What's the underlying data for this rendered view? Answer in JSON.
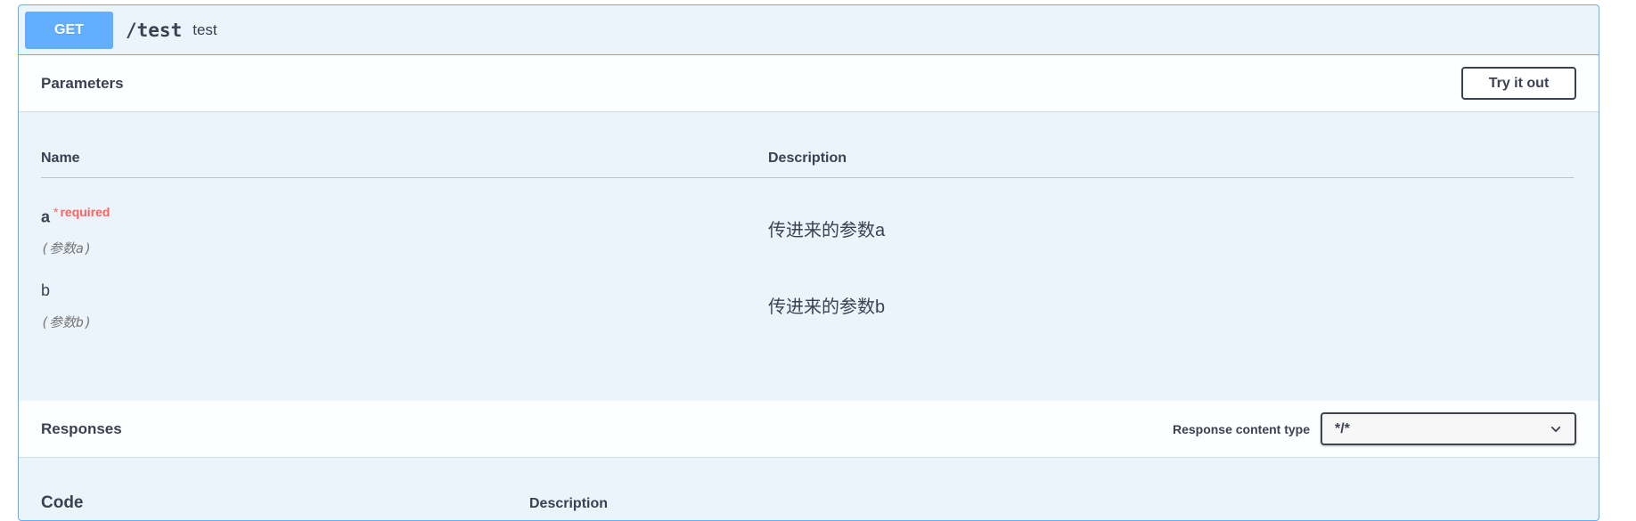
{
  "operation": {
    "method": "GET",
    "path": "/test",
    "summary": "test"
  },
  "parameters": {
    "title": "Parameters",
    "try_button": "Try it out",
    "col_name": "Name",
    "col_description": "Description",
    "items": [
      {
        "name": "a",
        "required_star": "*",
        "required_label": "required",
        "in": "(参数a)",
        "description": "传进来的参数a"
      },
      {
        "name": "b",
        "in": "(参数b)",
        "description": "传进来的参数b"
      }
    ]
  },
  "responses": {
    "title": "Responses",
    "content_type_label": "Response content type",
    "content_type_value": "*/*",
    "col_code": "Code",
    "col_description": "Description"
  }
}
